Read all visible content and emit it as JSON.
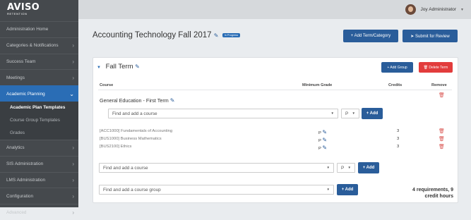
{
  "logo": {
    "line1": "AVISO",
    "line2": "RETENTION"
  },
  "sidebar": {
    "items": [
      {
        "label": "Administration Home",
        "chev": ""
      },
      {
        "label": "Categories & Notifications",
        "chev": "›"
      },
      {
        "label": "Success Team",
        "chev": "›"
      },
      {
        "label": "Meetings",
        "chev": "›"
      },
      {
        "label": "Academic Planning",
        "chev": "⌄"
      },
      {
        "label": "Analytics",
        "chev": "›"
      },
      {
        "label": "SIS Administration",
        "chev": "›"
      },
      {
        "label": "LMS Administration",
        "chev": "›"
      },
      {
        "label": "Configuration",
        "chev": "›"
      },
      {
        "label": "Advanced",
        "chev": "›"
      }
    ],
    "sub_items": [
      "Academic Plan Templates",
      "Course Group Templates",
      "Grades"
    ]
  },
  "topbar": {
    "user": "Joy Administrator",
    "caret": "▼"
  },
  "header": {
    "title": "Accounting Technology Fall 2017",
    "badge": "In Progress",
    "add_term_label": "+ Add Term/Category",
    "submit_label": "➤ Submit for Review"
  },
  "term": {
    "title": "Fall Term",
    "add_group_label": "+ Add Group",
    "delete_label": "🗑 Delete Term"
  },
  "table": {
    "headers": {
      "course": "Course",
      "min_grade": "Minimum Grade",
      "credits": "Credits",
      "remove": "Remove"
    }
  },
  "group": {
    "title": "General Education - First Term",
    "placeholder": "Find and add a course",
    "grade": "P",
    "add_label": "+ Add"
  },
  "courses": [
    {
      "name": "[ACC1000] Fundamentals of Accounting",
      "grade": "P",
      "credits": "3"
    },
    {
      "name": "[BUS1000] Business Mathematics",
      "grade": "P",
      "credits": "3"
    },
    {
      "name": "[BUS2100] Ethics",
      "grade": "P",
      "credits": "3"
    }
  ],
  "term_course": {
    "placeholder": "Find and add a course",
    "grade": "P",
    "add_label": "+ Add"
  },
  "term_group": {
    "placeholder": "Find and add a course group",
    "add_label": "+ Add"
  },
  "summary": {
    "line1": "4 requirements, 9",
    "line2": "credit hours"
  }
}
